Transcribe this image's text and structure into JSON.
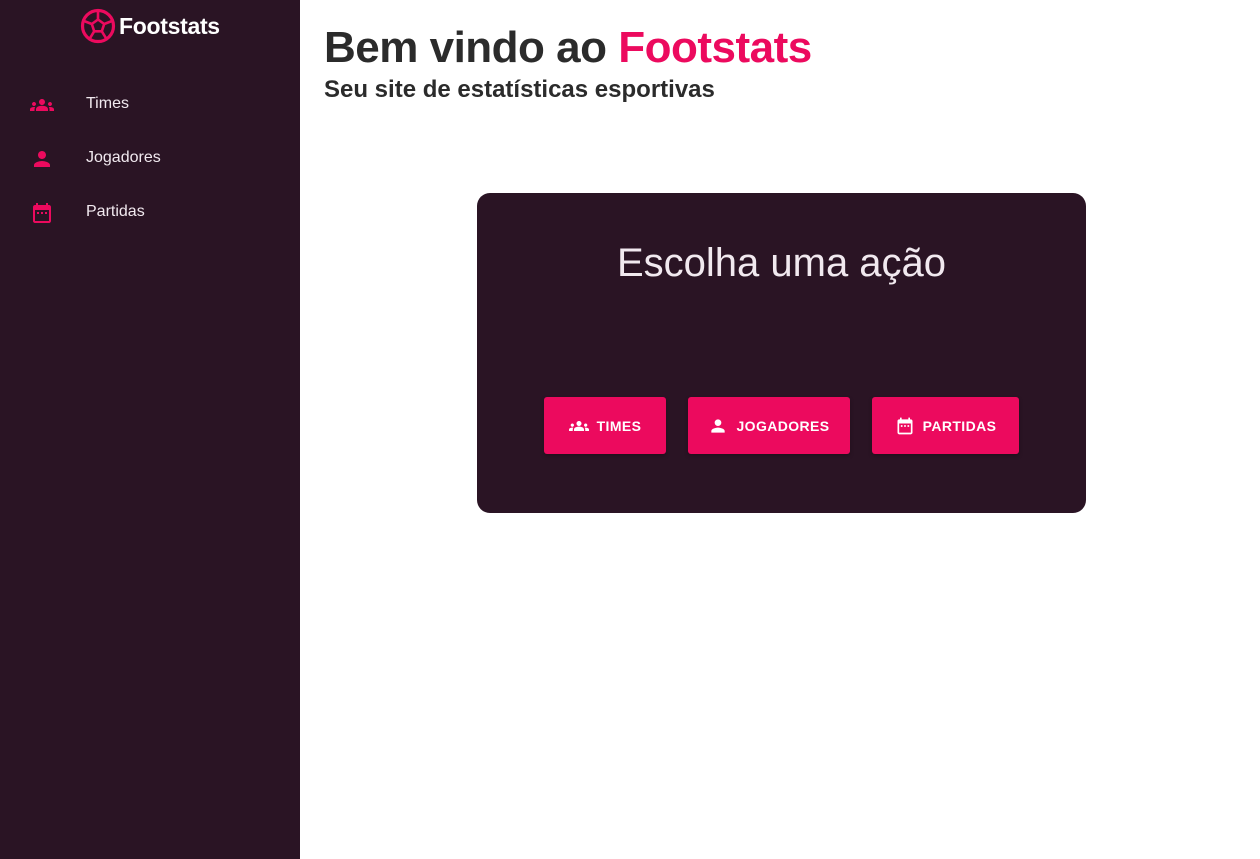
{
  "brand": {
    "name": "Footstats",
    "logo_icon": "soccer-ball-icon"
  },
  "sidebar": {
    "items": [
      {
        "label": "Times",
        "icon": "groups-icon"
      },
      {
        "label": "Jogadores",
        "icon": "person-icon"
      },
      {
        "label": "Partidas",
        "icon": "calendar-icon"
      }
    ]
  },
  "header": {
    "welcome_prefix": "Bem vindo ao ",
    "welcome_brand": "Footstats",
    "subtitle": "Seu site de estatísticas esportivas"
  },
  "card": {
    "title": "Escolha uma ação",
    "buttons": [
      {
        "label": "TIMES",
        "icon": "groups-icon"
      },
      {
        "label": "JOGADORES",
        "icon": "person-icon"
      },
      {
        "label": "PARTIDAS",
        "icon": "calendar-icon"
      }
    ]
  },
  "colors": {
    "sidebar_bg": "#2a1424",
    "accent": "#ec0a5e",
    "heading_text": "#2b2b2b",
    "card_bg": "#2a1424",
    "light_text": "#f1e9ef"
  }
}
